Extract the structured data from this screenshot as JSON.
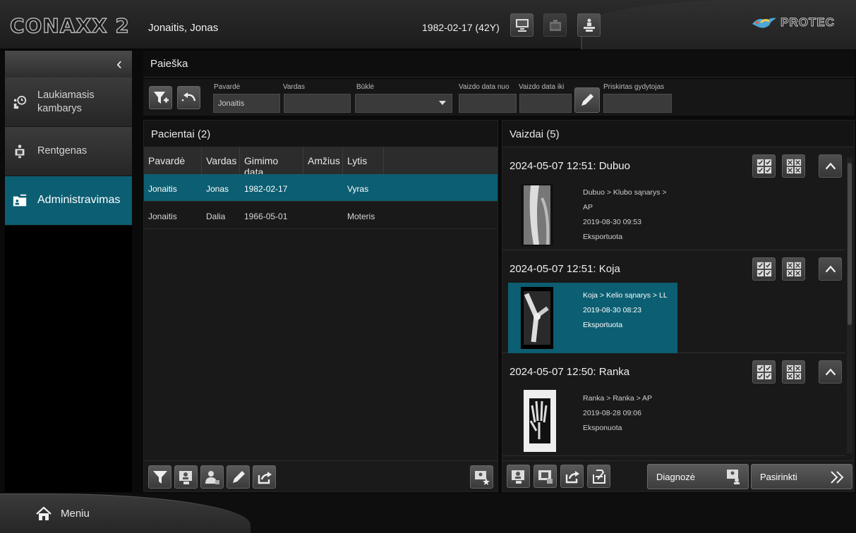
{
  "header": {
    "app_name": "CONAXX 2",
    "patient_name": "Jonaitis, Jonas",
    "patient_dob": "1982-02-17 (42Y)",
    "brand": "PROTEC"
  },
  "sidebar": {
    "items": [
      {
        "label": "Laukiamasis kambarys",
        "icon": "waiting-room-icon"
      },
      {
        "label": "Rentgenas",
        "icon": "xray-device-icon"
      },
      {
        "label": "Administravimas",
        "icon": "admin-folder-icon"
      }
    ]
  },
  "search": {
    "title": "Paieška",
    "fields": {
      "surname_label": "Pavardė",
      "surname_value": "Jonaitis",
      "name_label": "Vardas",
      "name_value": "",
      "status_label": "Būklė",
      "status_value": "",
      "date_from_label": "Vaizdo data nuo",
      "date_to_label": "Vaizdo data iki",
      "doctor_label": "Priskirtas gydytojas"
    }
  },
  "patients": {
    "title": "Pacientai (2)",
    "columns": [
      "Pavardė",
      "Vardas",
      "Gimimo data",
      "Amžius",
      "Lytis"
    ],
    "rows": [
      {
        "surname": "Jonaitis",
        "name": "Jonas",
        "dob": "1982-02-17",
        "age": "",
        "sex": "Vyras"
      },
      {
        "surname": "Jonaitis",
        "name": "Dalia",
        "dob": "1966-05-01",
        "age": "",
        "sex": "Moteris"
      }
    ]
  },
  "images": {
    "title": "Vaizdai (5)",
    "groups": [
      {
        "title": "2024-05-07 12:51:  Dubuo",
        "path": "Dubuo > Klubo sąnarys > AP",
        "datetime": "2019-08-30 09:53",
        "status": "Eksportuota"
      },
      {
        "title": "2024-05-07 12:51:  Koja",
        "path": "Koja > Kelio sąnarys > LL",
        "datetime": "2019-08-30 08:23",
        "status": "Eksportuota"
      },
      {
        "title": "2024-05-07 12:50:  Ranka",
        "path": "Ranka > Ranka > AP",
        "datetime": "2019-08-28 09:06",
        "status": "Eksponuota"
      }
    ]
  },
  "actions": {
    "diagnose": "Diagnozė",
    "select": "Pasirinkti"
  },
  "footer": {
    "menu": "Meniu"
  },
  "colors": {
    "accent": "#0c5e72"
  }
}
